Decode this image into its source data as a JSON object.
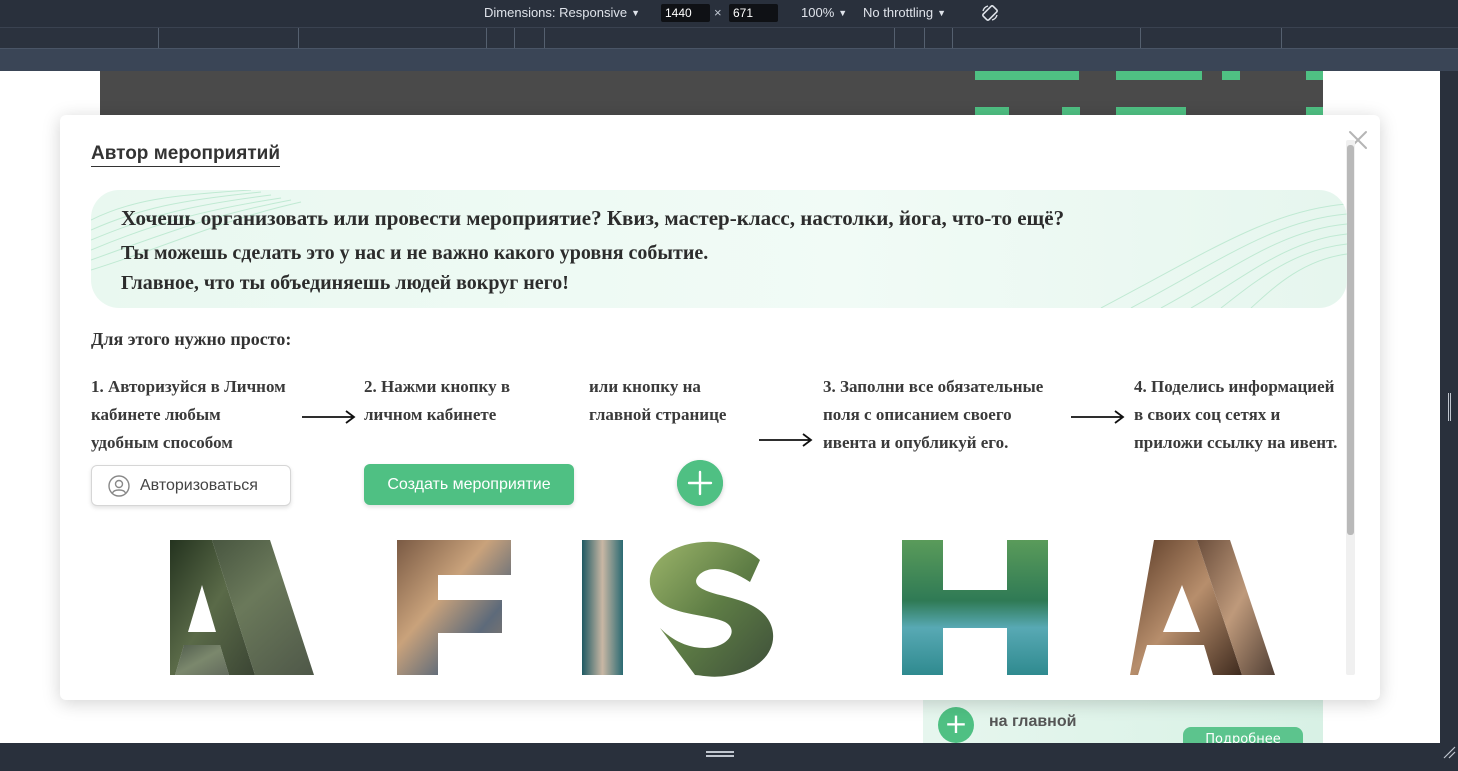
{
  "devtools": {
    "dimensions_label": "Dimensions: Responsive",
    "width_value": "1440",
    "height_value": "671",
    "times": "×",
    "zoom": "100%",
    "throttling": "No throttling"
  },
  "background_page": {
    "card_label": "на главной",
    "card_button": "Подробнее"
  },
  "modal": {
    "title": "Автор мероприятий",
    "hero": {
      "line1": "Хочешь организовать или провести мероприятие? Квиз, мастер-класс, настолки, йога, что-то ещё?",
      "line2": "Ты можешь сделать это у нас и не важно какого уровня событие.",
      "line3": "Главное, что ты объединяешь людей вокруг него!"
    },
    "subheading": "Для этого нужно просто:",
    "steps": [
      {
        "lines": [
          "1. Авторизуйся в Личном",
          "кабинете любым",
          "удобным способом"
        ]
      },
      {
        "lines": [
          "2. Нажми кнопку в",
          "личном кабинете"
        ]
      },
      {
        "lines": [
          "или кнопку на",
          "главной странице"
        ]
      },
      {
        "lines": [
          "3. Заполни все обязательные",
          "поля с описанием своего",
          "ивента и опубликуй его."
        ]
      },
      {
        "lines": [
          "4. Поделись информацией",
          "в своих соц сетях и",
          "приложи ссылку на ивент."
        ]
      }
    ],
    "auth_button": "Авторизоваться",
    "create_button": "Создать мероприятие",
    "afisha_letters": [
      "A",
      "F",
      "I",
      "S",
      "H",
      "A"
    ]
  },
  "colors": {
    "accent": "#4fc083",
    "hero_bg": "#eaf8f1",
    "devtools_bg": "#29303c"
  },
  "icons": [
    "rotate-icon",
    "close-icon",
    "user-icon",
    "plus-icon",
    "arrow-right-icon"
  ]
}
